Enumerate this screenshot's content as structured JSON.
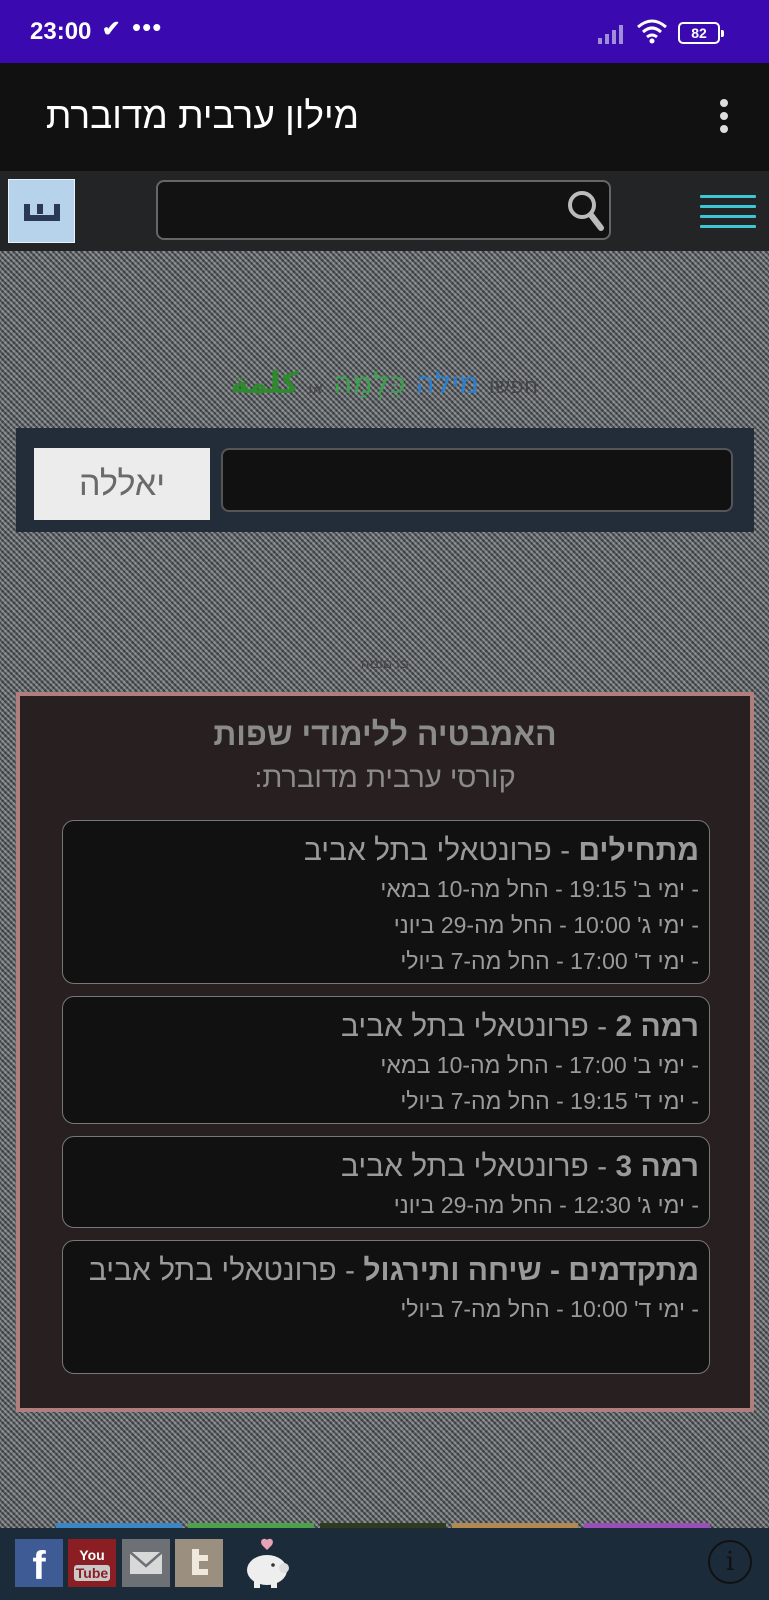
{
  "status_bar": {
    "time": "23:00",
    "notification_icon": "checkmark-flag",
    "more": "•••",
    "battery": "82"
  },
  "app_bar": {
    "title": "מילון ערבית מדוברת"
  },
  "toolbar": {
    "search_value": ""
  },
  "tagline": {
    "search": "חפשו",
    "word_hebrew": "מילה",
    "word_transliterated": "כִּלְמֵה",
    "or": "או",
    "word_arabic": "كلمة"
  },
  "search": {
    "button_label": "יאללה",
    "input_value": ""
  },
  "ad_label": "פרסומת",
  "promo": {
    "title": "האמבטיה ללימודי שפות",
    "subtitle": "קורסי ערבית מדוברת:",
    "courses": [
      {
        "level": "מתחילים",
        "desc": " - פרונטאלי בתל אביב",
        "lines": [
          "- ימי ב' 19:15 - החל מה-10 במאי",
          "- ימי ג' 10:00 - החל מה-29 ביוני",
          "- ימי ד' 17:00 - החל מה-7 ביולי"
        ]
      },
      {
        "level": "רמה 2",
        "desc": " - פרונטאלי בתל אביב",
        "lines": [
          "- ימי ב' 17:00 - החל מה-10 במאי",
          "- ימי ד' 19:15 - החל מה-7 ביולי"
        ]
      },
      {
        "level": "רמה 3",
        "desc": " - פרונטאלי בתל אביב",
        "lines": [
          "- ימי ג' 12:30 - החל מה-29 ביוני"
        ]
      },
      {
        "level": "מתקדמים - שיחה ותירגול",
        "desc": " - פרונטאלי בתל אביב",
        "lines": [
          "- ימי ד' 10:00 - החל מה-7 ביולי"
        ]
      }
    ]
  },
  "bottom_bar": {
    "facebook": "f",
    "youtube_top": "You",
    "youtube_bottom": "Tube",
    "info": "i",
    "strip_colors": [
      "#3d86c4",
      "#4fa04a",
      "#2f3a1e",
      "#b08a50",
      "#9a4fb8"
    ]
  }
}
